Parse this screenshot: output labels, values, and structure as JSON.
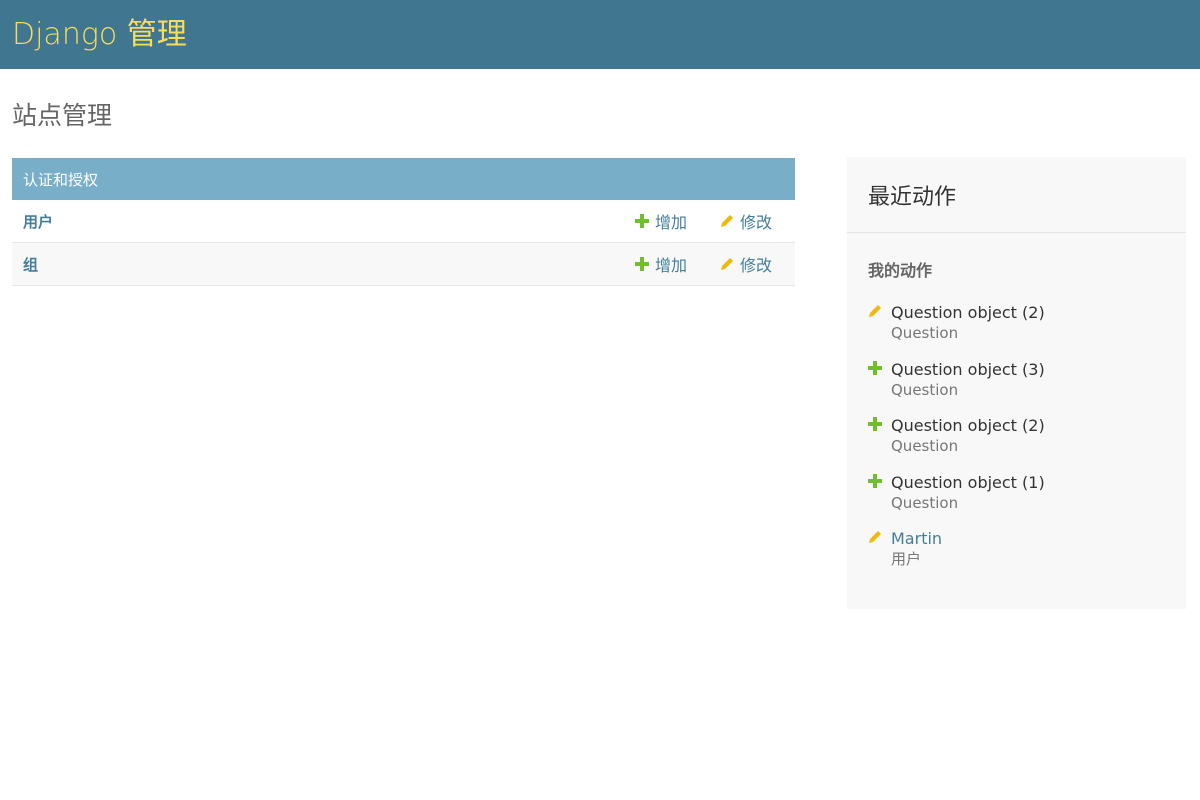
{
  "header": {
    "brand": "Django 管理"
  },
  "page": {
    "title": "站点管理"
  },
  "app_module": {
    "caption": "认证和授权",
    "models": [
      {
        "name": "用户",
        "add_label": "增加",
        "change_label": "修改"
      },
      {
        "name": "组",
        "add_label": "增加",
        "change_label": "修改"
      }
    ]
  },
  "recent_actions": {
    "title": "最近动作",
    "my_actions_title": "我的动作",
    "items": [
      {
        "icon": "pencil-icon",
        "object": "Question object (2)",
        "type": "Question"
      },
      {
        "icon": "plus-icon",
        "object": "Question object (3)",
        "type": "Question"
      },
      {
        "icon": "plus-icon",
        "object": "Question object (2)",
        "type": "Question"
      },
      {
        "icon": "plus-icon",
        "object": "Question object (1)",
        "type": "Question"
      },
      {
        "icon": "pencil-icon",
        "object": "Martin",
        "type": "用户"
      }
    ]
  },
  "colors": {
    "header_bg": "#417690",
    "brand_text": "#f5dd5d",
    "module_caption_bg": "#79aec8",
    "link": "#447e9b",
    "add_icon": "#70bf2b",
    "change_icon": "#efb80b",
    "panel_bg": "#f8f8f8"
  }
}
